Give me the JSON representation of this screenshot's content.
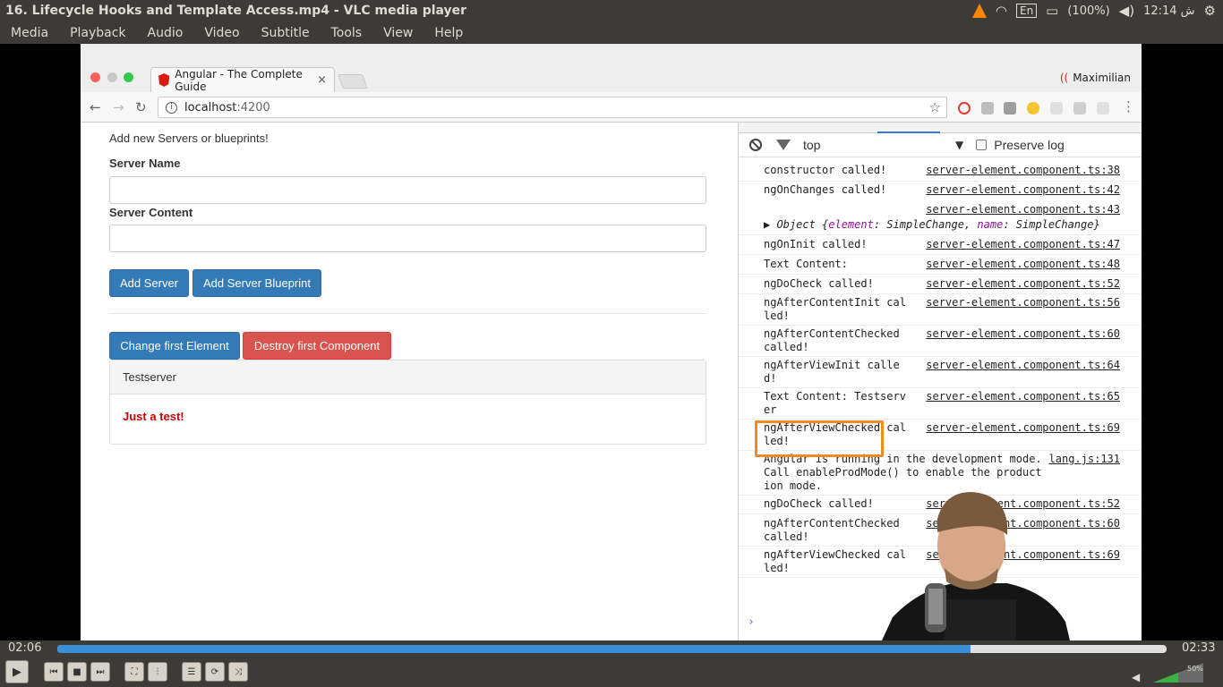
{
  "system": {
    "window_title": "16. Lifecycle Hooks and Template Access.mp4 - VLC media player",
    "keyboard": "En",
    "battery": "(100%)",
    "clock": "12:14 ش"
  },
  "vlc_menu": [
    "Media",
    "Playback",
    "Audio",
    "Video",
    "Subtitle",
    "Tools",
    "View",
    "Help"
  ],
  "browser": {
    "tab_title": "Angular - The Complete Guide",
    "tab_close": "×",
    "profile": "Maximilian",
    "url_host": "localhost",
    "url_port": ":4200"
  },
  "page": {
    "intro": "Add new Servers or blueprints!",
    "server_name_label": "Server Name",
    "server_content_label": "Server Content",
    "add_server": "Add Server",
    "add_blueprint": "Add Server Blueprint",
    "change_first": "Change first Element",
    "destroy_first": "Destroy first Component",
    "panel_heading": "Testserver",
    "panel_body": "Just a test!"
  },
  "devtools": {
    "context": "top",
    "preserve_log": "Preserve log",
    "object_line": {
      "prefix": "▶ Object {",
      "k1": "element",
      "v1": ": SimpleChange, ",
      "k2": "name",
      "v2": ": SimpleChange}"
    },
    "logs": [
      {
        "msg": "constructor called!",
        "src": "server-element.component.ts:38"
      },
      {
        "msg": "ngOnChanges called!",
        "src": "server-element.component.ts:42"
      },
      {
        "msg": "",
        "src": "server-element.component.ts:43"
      },
      {
        "msg": "ngOnInit called!",
        "src": "server-element.component.ts:47"
      },
      {
        "msg": "Text Content:",
        "src": "server-element.component.ts:48"
      },
      {
        "msg": "ngDoCheck called!",
        "src": "server-element.component.ts:52"
      },
      {
        "msg": "ngAfterContentInit called!",
        "src": "server-element.component.ts:56"
      },
      {
        "msg": "ngAfterContentChecked called!",
        "src": "server-element.component.ts:60"
      },
      {
        "msg": "ngAfterViewInit called!",
        "src": "server-element.component.ts:64"
      },
      {
        "msg": "Text Content: Testserver",
        "src": "server-element.component.ts:65"
      },
      {
        "msg": "ngAfterViewChecked called!",
        "src": "server-element.component.ts:69"
      },
      {
        "msg": "Angular is running in the development mode. Call enableProdMode() to enable the production mode.",
        "src": "lang.js:131"
      },
      {
        "msg": "ngDoCheck called!",
        "src": "server-element.component.ts:52"
      },
      {
        "msg": "ngAfterContentChecked called!",
        "src": "server-element.component.ts:60"
      },
      {
        "msg": "ngAfterViewChecked called!",
        "src": "server-element.component.ts:69"
      }
    ],
    "prompt": "›"
  },
  "player": {
    "elapsed": "02:06",
    "total": "02:33",
    "progress": 0.823,
    "volume_label": "50%",
    "volume": 0.5
  },
  "colors": {
    "accent": "#3a8fd8",
    "highlight": "#f08a24",
    "primary_button": "#337ab7",
    "danger_button": "#d9534f"
  }
}
